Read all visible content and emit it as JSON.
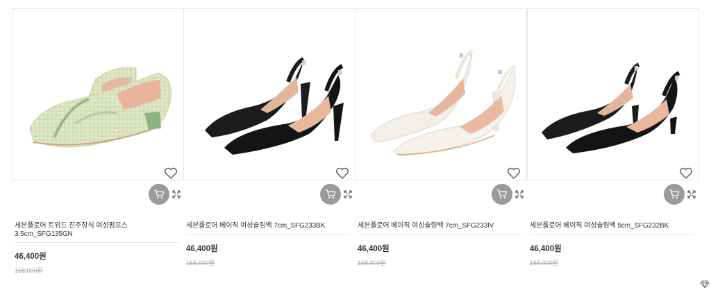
{
  "products": [
    {
      "name": "세븐플로어 트위드 진주장식 여성펌프스 3.5cm_SFG135GN",
      "price": "46,400원",
      "original_price": "168,000원",
      "image": "green tweed pumps"
    },
    {
      "name": "세븐플로어 베이직 여성슬링백 7cm_SFG233BK",
      "price": "46,400원",
      "original_price": "168,000원",
      "image": "black slingback heels"
    },
    {
      "name": "세븐플로어 베이직 여성슬링백 7cm_SFG233IV",
      "price": "46,400원",
      "original_price": "168,000원",
      "image": "ivory slingback heels"
    },
    {
      "name": "세븐플로어 베이직 여성슬링백 5cm_SFG232BK",
      "price": "46,400원",
      "original_price": "168,000원",
      "image": "black slingback kitten heels"
    }
  ],
  "icons": {
    "wishlist": "heart-icon",
    "cart": "cart-icon",
    "quick_view": "expand-icon",
    "corner": "diamond-icon"
  },
  "colors": {
    "cart_button": "#9a9a9a",
    "text": "#333333",
    "original_price": "#aaaaaa",
    "border": "#e6e6e6"
  }
}
